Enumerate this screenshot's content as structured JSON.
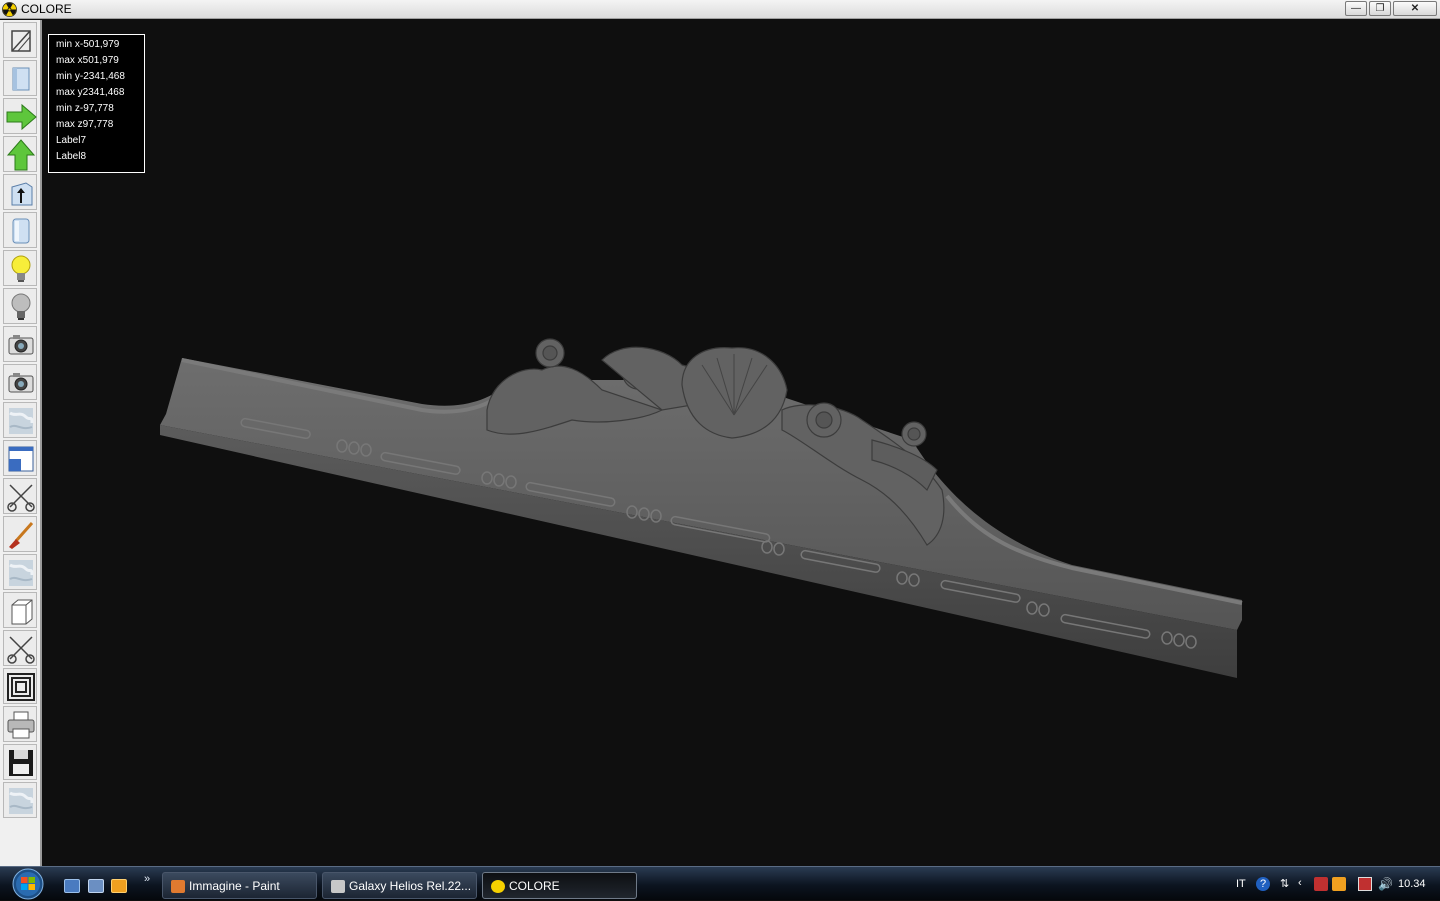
{
  "window": {
    "title": "COLORE",
    "controls": {
      "minimize": "—",
      "maximize": "❐",
      "close": "✕"
    }
  },
  "toolbar": {
    "tools": [
      {
        "name": "wireframe-view",
        "icon": "wireframe-box-icon"
      },
      {
        "name": "solid-view",
        "icon": "solid-box-icon"
      },
      {
        "name": "rotate-right",
        "icon": "green-arrow-right-icon"
      },
      {
        "name": "rotate-up",
        "icon": "green-arrow-up-icon"
      },
      {
        "name": "extrude",
        "icon": "box-arrow-icon"
      },
      {
        "name": "cylinder-view",
        "icon": "cylinder-icon"
      },
      {
        "name": "light-on",
        "icon": "lightbulb-on-icon"
      },
      {
        "name": "light-off",
        "icon": "lightbulb-off-icon"
      },
      {
        "name": "snapshot",
        "icon": "camera-icon"
      },
      {
        "name": "snapshot-2",
        "icon": "camera-icon"
      },
      {
        "name": "texture-1",
        "icon": "marble-texture-icon"
      },
      {
        "name": "window-layout",
        "icon": "window-icon"
      },
      {
        "name": "cut",
        "icon": "scissors-icon"
      },
      {
        "name": "paint",
        "icon": "brush-icon"
      },
      {
        "name": "texture-2",
        "icon": "marble-texture-icon"
      },
      {
        "name": "plain-box",
        "icon": "plain-box-icon"
      },
      {
        "name": "cut-2",
        "icon": "scissors-icon"
      },
      {
        "name": "frame",
        "icon": "concentric-frame-icon"
      },
      {
        "name": "print",
        "icon": "printer-icon"
      },
      {
        "name": "save",
        "icon": "floppy-disk-icon"
      },
      {
        "name": "texture-3",
        "icon": "marble-texture-icon"
      }
    ]
  },
  "info": {
    "lines": [
      "min x-501,979",
      "max x501,979",
      "min y-2341,468",
      "max y2341,468",
      "min z-97,778",
      "max z97,778",
      "Label7",
      "Label8"
    ]
  },
  "taskbar": {
    "more": "»",
    "tasks": [
      {
        "label": "Immagine - Paint",
        "active": false
      },
      {
        "label": "Galaxy Helios  Rel.22...",
        "active": false
      },
      {
        "label": "COLORE",
        "active": true
      }
    ],
    "language": "IT",
    "clock": "10.34"
  },
  "colors": {
    "viewport_bg": "#0f0f0f",
    "model": "#5a5a5a",
    "accent_green": "#3cc43c"
  }
}
